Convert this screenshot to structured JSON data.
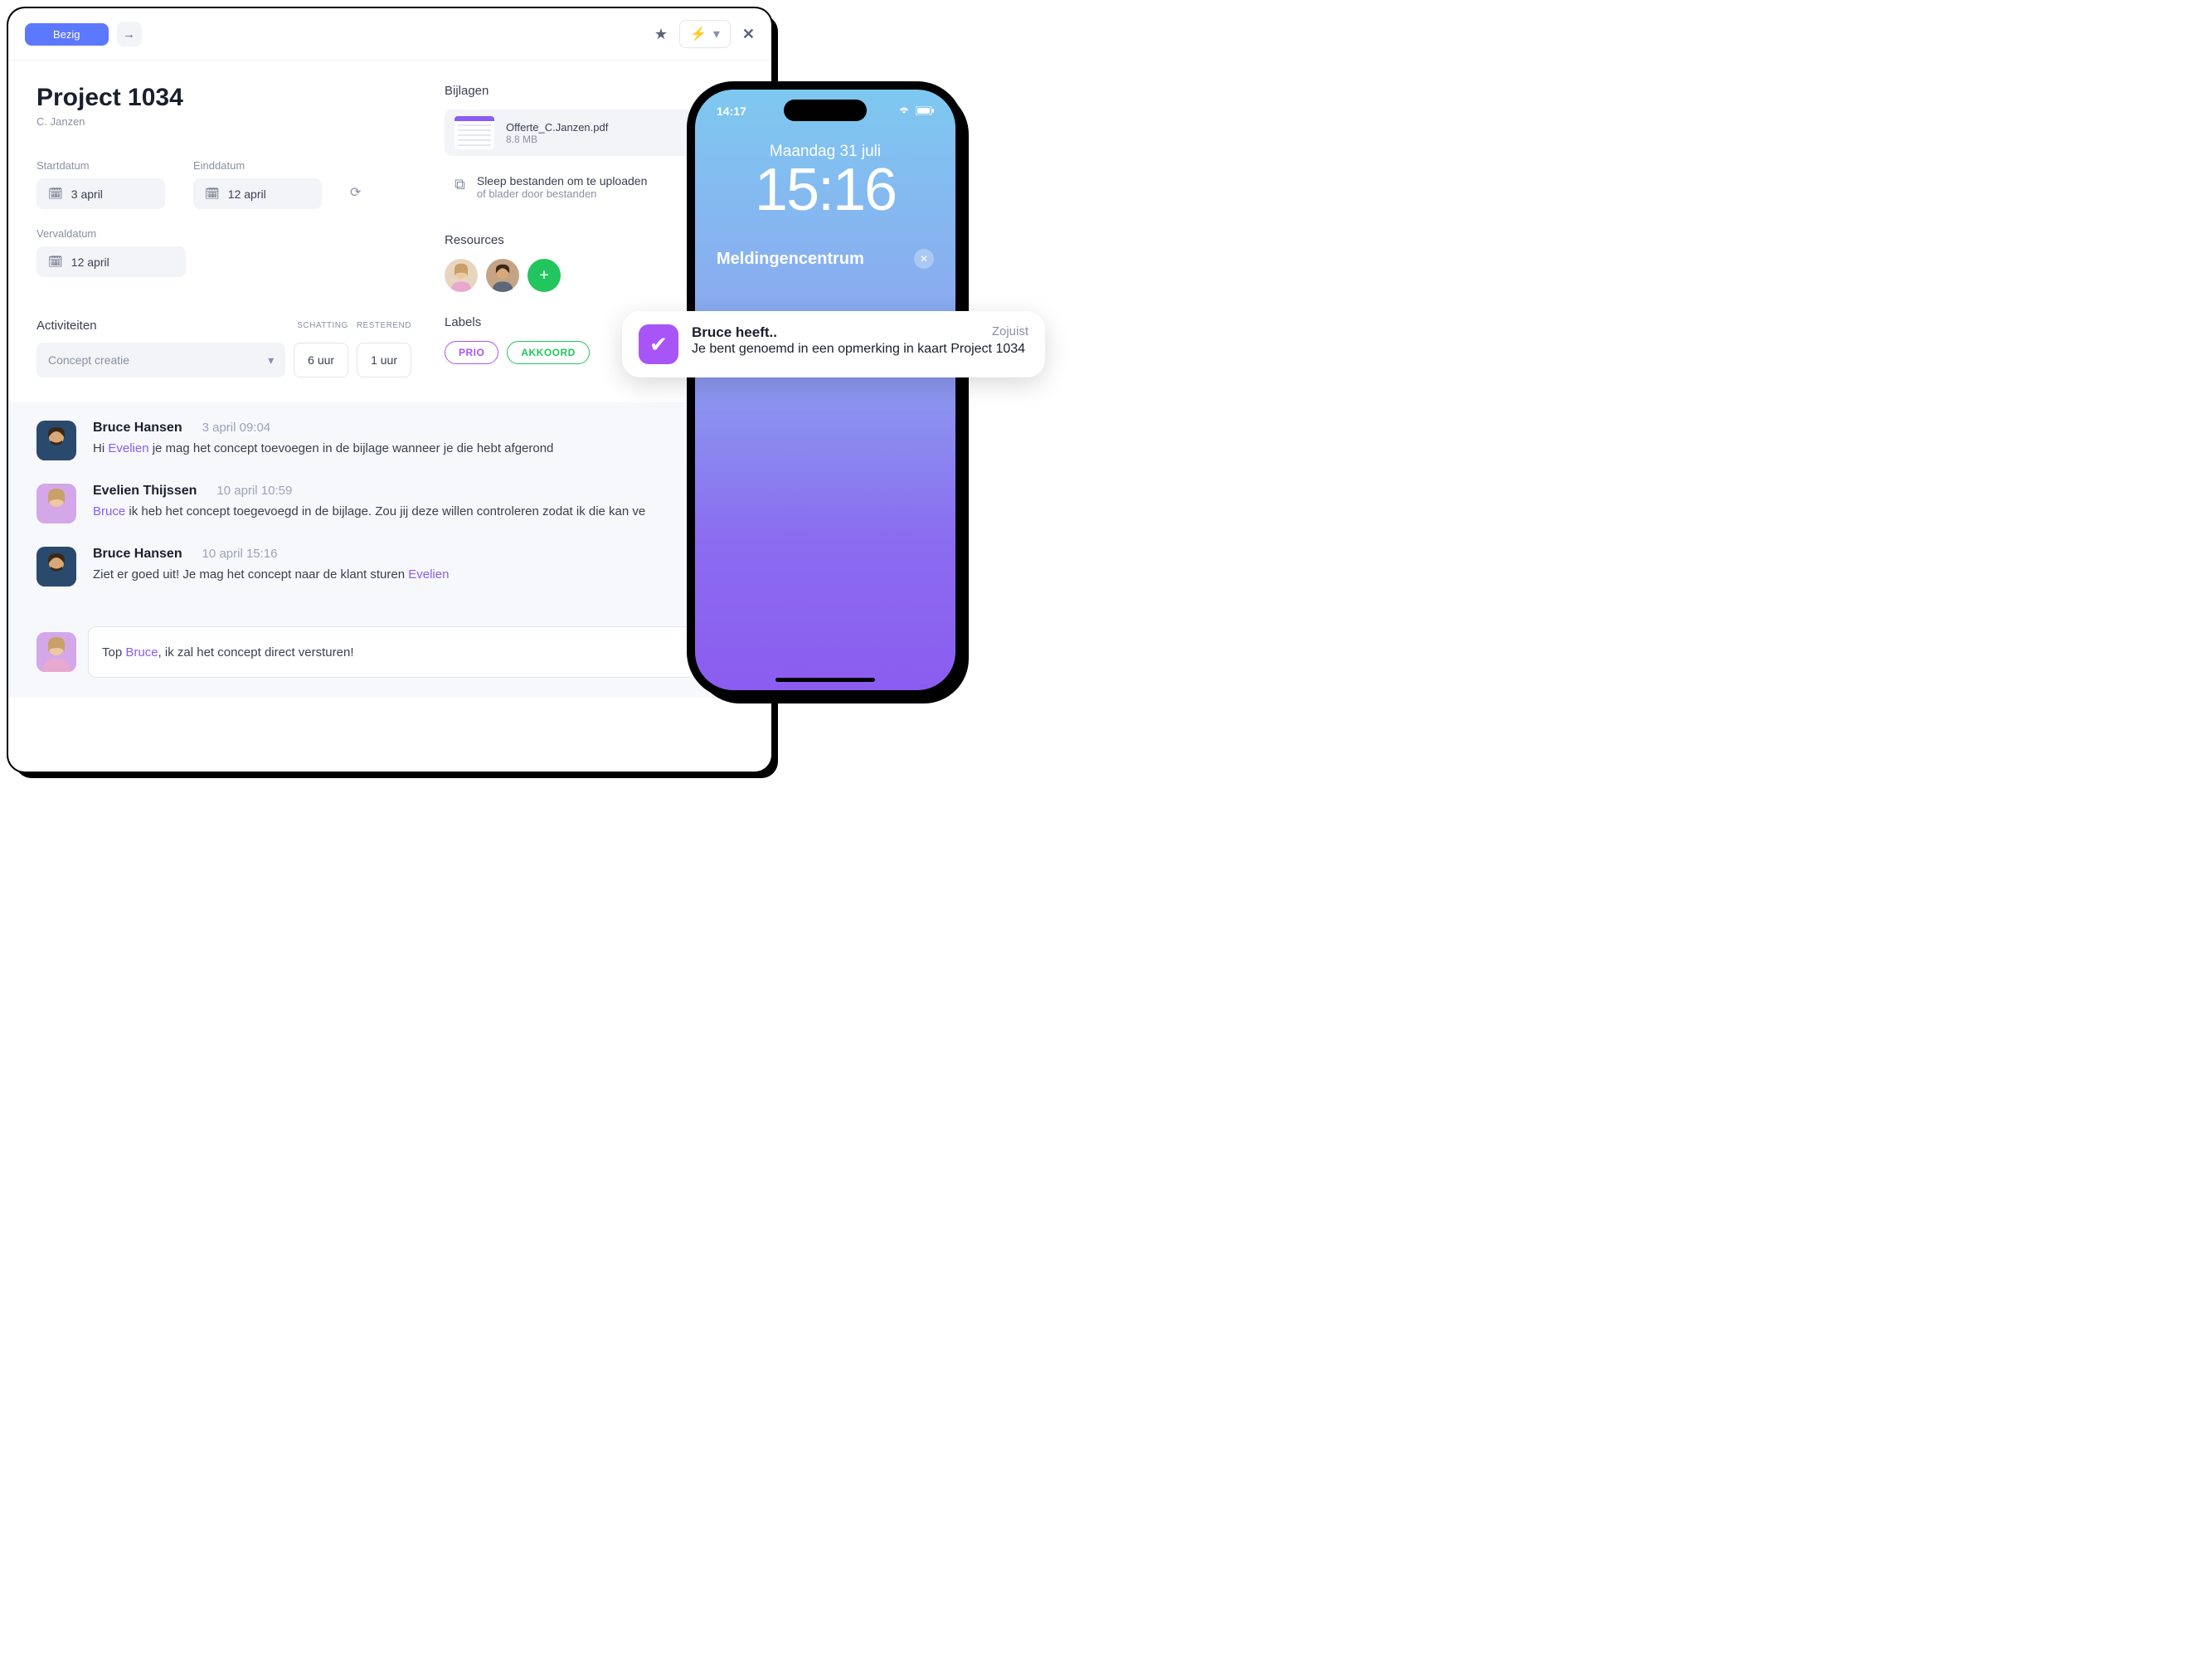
{
  "topbar": {
    "status": "Bezig"
  },
  "project": {
    "title": "Project 1034",
    "owner": "C. Janzen"
  },
  "dates": {
    "start_label": "Startdatum",
    "start_value": "3 april",
    "end_label": "Einddatum",
    "end_value": "12 april",
    "due_label": "Vervaldatum",
    "due_value": "12 april"
  },
  "activities": {
    "title": "Activiteiten",
    "col_estimate": "SCHATTING",
    "col_remaining": "RESTEREND",
    "select_value": "Concept creatie",
    "estimate": "6 uur",
    "remaining": "1 uur"
  },
  "attachments": {
    "title": "Bijlagen",
    "file_name": "Offerte_C.Janzen.pdf",
    "file_size": "8.8 MB",
    "upload_title": "Sleep bestanden om te uploaden",
    "upload_sub": "of blader door bestanden"
  },
  "resources": {
    "title": "Resources"
  },
  "labels": {
    "title": "Labels",
    "prio": "PRIO",
    "akkoord": "AKKOORD"
  },
  "comments": [
    {
      "author": "Bruce Hansen",
      "time": "3 april 09:04",
      "prefix": "Hi ",
      "mention": "Evelien",
      "suffix": " je mag het concept toevoegen in de bijlage wanneer je die hebt afgerond",
      "gender": "male"
    },
    {
      "author": "Evelien Thijssen",
      "time": "10 april 10:59",
      "prefix": "",
      "mention": "Bruce",
      "suffix": " ik heb het concept toegevoegd in de bijlage. Zou jij deze willen controleren zodat ik die kan ve",
      "gender": "female"
    },
    {
      "author": "Bruce Hansen",
      "time": "10 april 15:16",
      "prefix": "Ziet er goed uit! Je mag het concept naar de klant sturen ",
      "mention": "Evelien",
      "suffix": "",
      "gender": "male"
    }
  ],
  "compose": {
    "prefix": "Top ",
    "mention": "Bruce",
    "suffix": ", ik zal het concept direct versturen!"
  },
  "phone": {
    "status_time": "14:17",
    "date": "Maandag 31 juli",
    "time": "15:16",
    "notif_center": "Meldingencentrum"
  },
  "notification": {
    "title": "Bruce heeft..",
    "time": "Zojuist",
    "text": "Je bent genoemd in een opmerking in kaart Project 1034"
  }
}
